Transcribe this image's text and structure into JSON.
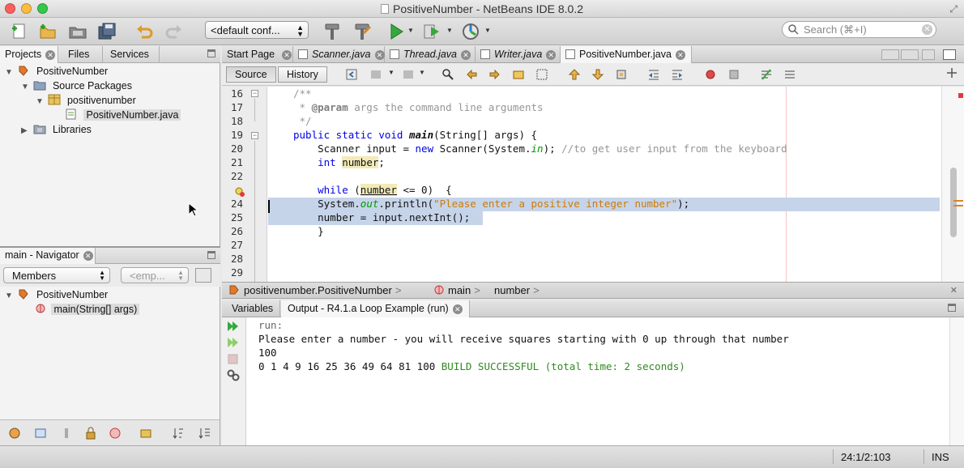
{
  "window": {
    "title": "PositiveNumber - NetBeans IDE 8.0.2"
  },
  "toolbar": {
    "config": "<default conf...",
    "search_placeholder": "Search (⌘+I)",
    "icons": [
      "new-file-icon",
      "new-project-icon",
      "open-project-icon",
      "save-all-icon",
      "undo-icon",
      "redo-icon",
      "build-icon",
      "clean-build-icon",
      "run-icon",
      "debug-icon",
      "profile-icon"
    ]
  },
  "left_panel": {
    "tabs": [
      {
        "label": "Projects",
        "active": true
      },
      {
        "label": "Files",
        "active": false
      },
      {
        "label": "Services",
        "active": false
      }
    ],
    "tree": [
      {
        "label": "PositiveNumber",
        "expanded": true
      },
      {
        "label": "Source Packages",
        "expanded": true
      },
      {
        "label": "positivenumber",
        "expanded": true
      },
      {
        "label": "PositiveNumber.java",
        "selected": true
      },
      {
        "label": "Libraries",
        "expanded": false
      }
    ]
  },
  "navigator": {
    "tab_label": "main - Navigator",
    "members_select": "Members",
    "filter_select": "<emp...",
    "tree": [
      {
        "label": "PositiveNumber"
      },
      {
        "label": "main(String[] args)"
      }
    ]
  },
  "editor": {
    "tabs": [
      {
        "label": "Start Page",
        "italic": false,
        "active": false
      },
      {
        "label": "Scanner.java",
        "italic": true,
        "active": false
      },
      {
        "label": "Thread.java",
        "italic": true,
        "active": false
      },
      {
        "label": "Writer.java",
        "italic": true,
        "active": false
      },
      {
        "label": "PositiveNumber.java",
        "italic": false,
        "active": true
      }
    ],
    "source_button": "Source",
    "history_button": "History",
    "line_numbers": [
      "16",
      "17",
      "18",
      "19",
      "20",
      "21",
      "22",
      "23",
      "24",
      "25",
      "26",
      "27",
      "28",
      "29"
    ],
    "code": {
      "l16": "/**",
      "l17_pre": " * ",
      "l17_tag": "@param",
      "l17_rest": " args the command line arguments",
      "l18": " */",
      "l19_kw": "public static void ",
      "l19_name": "main",
      "l19_rest": "(String[] args) {",
      "l20_a": "    Scanner input = ",
      "l20_kw": "new",
      "l20_b": " Scanner(System.",
      "l20_in": "in",
      "l20_c": "); ",
      "l20_cmt": "//to get user input from the keyboard",
      "l21_kw": "    int ",
      "l21_var": "number",
      "l21_end": ";",
      "l23_kw": "    while",
      "l23_a": " (",
      "l23_var": "number",
      "l23_b": " <= 0)  {",
      "l24_a": "    System.",
      "l24_out": "out",
      "l24_b": ".println(",
      "l24_str": "\"Please enter a positive integer number\"",
      "l24_c": ");",
      "l25": "    number = input.nextInt();",
      "l26": "    }"
    }
  },
  "breadcrumbs": [
    "positivenumber.PositiveNumber",
    "main",
    "number"
  ],
  "output": {
    "tabs": [
      {
        "label": "Variables",
        "active": false
      },
      {
        "label": "Output - R4.1.a Loop Example (run)",
        "active": true
      }
    ],
    "lines": {
      "run": "run:",
      "prompt": "Please enter a number - you will receive squares starting with 0 up through that number",
      "input": "100",
      "squares": "0 1 4 9 16 25 36 49 64 81 100 ",
      "build": "BUILD SUCCESSFUL (total time: 2 seconds)"
    }
  },
  "status": {
    "position": "24:1/2:103",
    "mode": "INS"
  },
  "colors": {
    "selection": "#c6d4ea",
    "keyword": "#0000e6",
    "string": "#ce7b00",
    "success": "#2e8b1e"
  }
}
